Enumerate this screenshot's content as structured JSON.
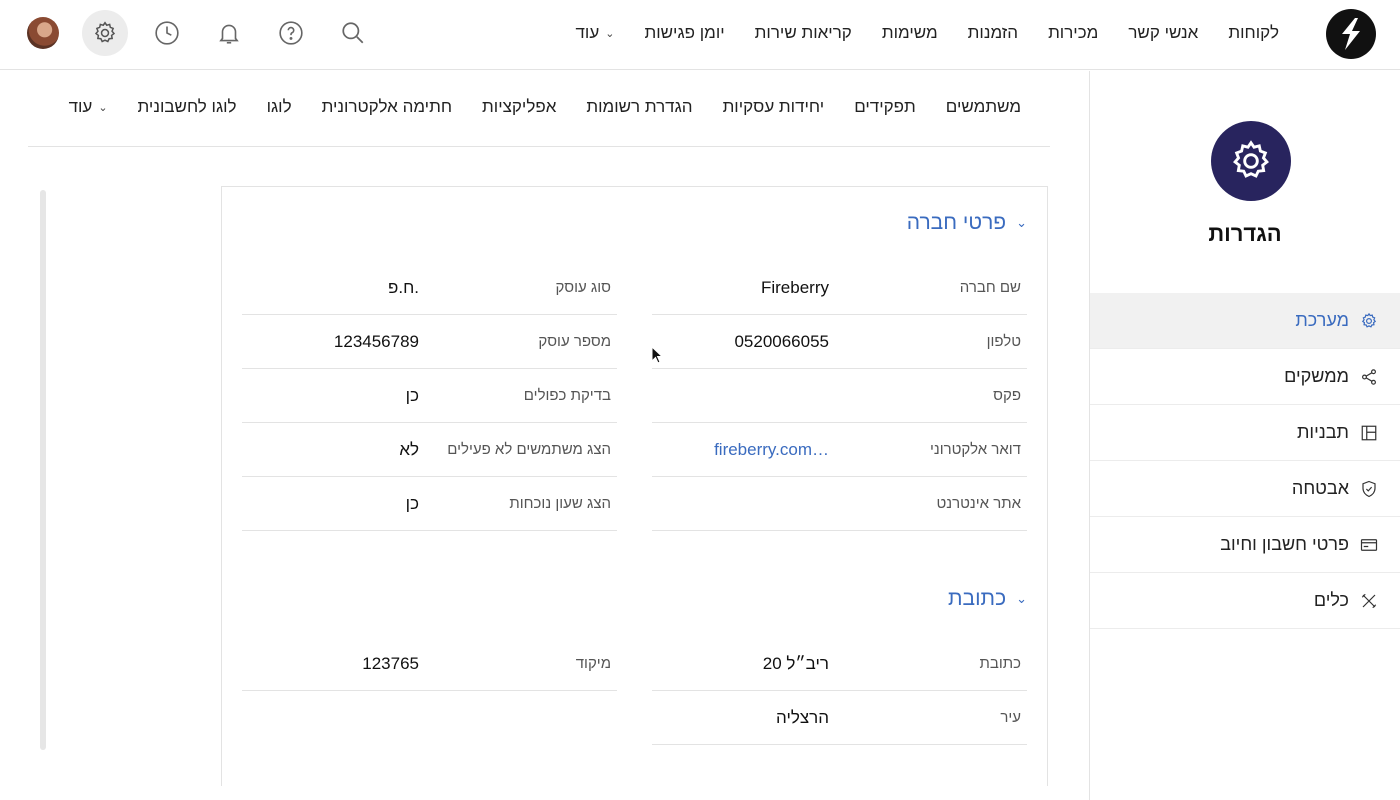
{
  "topnav": {
    "items": [
      {
        "label": "לקוחות"
      },
      {
        "label": "אנשי קשר"
      },
      {
        "label": "מכירות"
      },
      {
        "label": "הזמנות"
      },
      {
        "label": "משימות"
      },
      {
        "label": "קריאות שירות"
      },
      {
        "label": "יומן פגישות"
      },
      {
        "label": "עוד"
      }
    ],
    "icons": [
      "avatar",
      "gear-icon",
      "clock-icon",
      "bell-icon",
      "help-icon",
      "search-icon"
    ]
  },
  "sidebar": {
    "title": "הגדרות",
    "items": [
      {
        "label": "מערכת",
        "icon": "gear-icon",
        "active": true
      },
      {
        "label": "ממשקים",
        "icon": "share-icon"
      },
      {
        "label": "תבניות",
        "icon": "template-icon"
      },
      {
        "label": "אבטחה",
        "icon": "shield-icon"
      },
      {
        "label": "פרטי חשבון וחיוב",
        "icon": "card-icon"
      },
      {
        "label": "כלים",
        "icon": "tools-icon"
      }
    ]
  },
  "subnav": {
    "items": [
      {
        "label": "משתמשים"
      },
      {
        "label": "תפקידים"
      },
      {
        "label": "יחידות עסקיות"
      },
      {
        "label": "הגדרת רשומות"
      },
      {
        "label": "אפליקציות"
      },
      {
        "label": "חתימה אלקטרונית"
      },
      {
        "label": "לוגו"
      },
      {
        "label": "לוגו לחשבונית"
      },
      {
        "label": "עוד"
      }
    ]
  },
  "company": {
    "title": "פרטי חברה",
    "right": [
      {
        "label": "שם חברה",
        "value": "Fireberry"
      },
      {
        "label": "טלפון",
        "value": "0520066055"
      },
      {
        "label": "פקס",
        "value": ""
      },
      {
        "label": "דואר אלקטרוני",
        "value": "fireberry.com…"
      },
      {
        "label": "אתר אינטרנט",
        "value": ""
      }
    ],
    "left": [
      {
        "label": "סוג עוסק",
        "value": "ח.פ."
      },
      {
        "label": "מספר עוסק",
        "value": "123456789"
      },
      {
        "label": "בדיקת כפולים",
        "value": "כן"
      },
      {
        "label": "הצג משתמשים לא פעילים",
        "value": "לא"
      },
      {
        "label": "הצג שעון נוכחות",
        "value": "כן"
      }
    ]
  },
  "address": {
    "title": "כתובת",
    "right": [
      {
        "label": "כתובת",
        "value": "ריב״ל 20"
      },
      {
        "label": "עיר",
        "value": "הרצליה"
      }
    ],
    "left": [
      {
        "label": "מיקוד",
        "value": "123765"
      }
    ]
  },
  "colors": {
    "accent": "#3a6bbf",
    "brand_dark": "#28245e"
  }
}
